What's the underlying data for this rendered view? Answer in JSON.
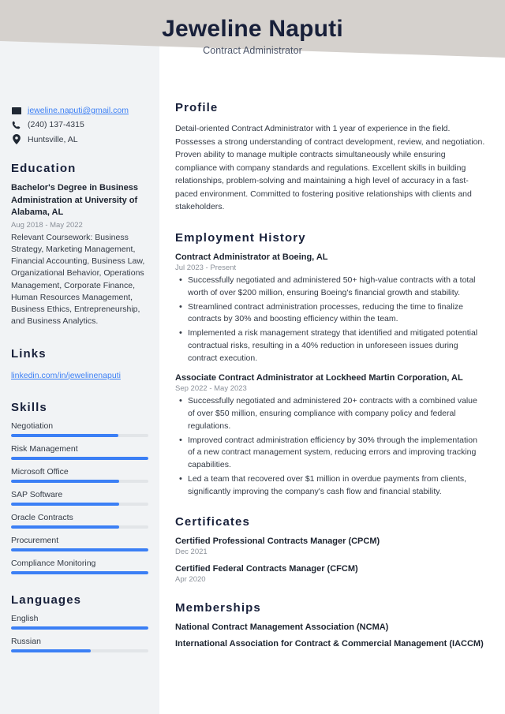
{
  "header": {
    "name": "Jeweline Naputi",
    "job_title": "Contract Administrator",
    "band_color": "#d5d1cd",
    "name_color": "#18203a"
  },
  "theme": {
    "accent": "#3b7ff5",
    "sidebar_bg": "#f1f3f5",
    "heading_color": "#18203a",
    "body_color": "#333a45",
    "muted_color": "#8a9099"
  },
  "sidebar": {
    "contact": [
      {
        "icon": "envelope-icon",
        "text": "jeweline.naputi@gmail.com",
        "is_link": true
      },
      {
        "icon": "phone-icon",
        "text": "(240) 137-4315",
        "is_link": false
      },
      {
        "icon": "location-pin-icon",
        "text": "Huntsville, AL",
        "is_link": false
      }
    ],
    "education": {
      "heading": "Education",
      "degree": "Bachelor's Degree in Business Administration at University of Alabama, AL",
      "date": "Aug 2018 - May 2022",
      "description": "Relevant Coursework: Business Strategy, Marketing Management, Financial Accounting, Business Law, Organizational Behavior, Operations Management, Corporate Finance, Human Resources Management, Business Ethics, Entrepreneurship, and Business Analytics."
    },
    "links": {
      "heading": "Links",
      "items": [
        {
          "label": "linkedin.com/in/jewelinenaputi"
        }
      ]
    },
    "skills": {
      "heading": "Skills",
      "items": [
        {
          "label": "Negotiation",
          "level": 78
        },
        {
          "label": "Risk Management",
          "level": 100
        },
        {
          "label": "Microsoft Office",
          "level": 79
        },
        {
          "label": "SAP Software",
          "level": 79
        },
        {
          "label": "Oracle Contracts",
          "level": 79
        },
        {
          "label": "Procurement",
          "level": 100
        },
        {
          "label": "Compliance Monitoring",
          "level": 100
        }
      ]
    },
    "languages": {
      "heading": "Languages",
      "items": [
        {
          "label": "English",
          "level": 100
        },
        {
          "label": "Russian",
          "level": 58
        }
      ]
    }
  },
  "main": {
    "profile": {
      "heading": "Profile",
      "text": "Detail-oriented Contract Administrator with 1 year of experience in the field. Possesses a strong understanding of contract development, review, and negotiation. Proven ability to manage multiple contracts simultaneously while ensuring compliance with company standards and regulations. Excellent skills in building relationships, problem-solving and maintaining a high level of accuracy in a fast-paced environment. Committed to fostering positive relationships with clients and stakeholders."
    },
    "employment": {
      "heading": "Employment History",
      "jobs": [
        {
          "title": "Contract Administrator at Boeing, AL",
          "date": "Jul 2023 - Present",
          "bullets": [
            "Successfully negotiated and administered 50+ high-value contracts with a total worth of over $200 million, ensuring Boeing's financial growth and stability.",
            "Streamlined contract administration processes, reducing the time to finalize contracts by 30% and boosting efficiency within the team.",
            "Implemented a risk management strategy that identified and mitigated potential contractual risks, resulting in a 40% reduction in unforeseen issues during contract execution."
          ]
        },
        {
          "title": "Associate Contract Administrator at Lockheed Martin Corporation, AL",
          "date": "Sep 2022 - May 2023",
          "bullets": [
            "Successfully negotiated and administered 20+ contracts with a combined value of over $50 million, ensuring compliance with company policy and federal regulations.",
            "Improved contract administration efficiency by 30% through the implementation of a new contract management system, reducing errors and improving tracking capabilities.",
            "Led a team that recovered over $1 million in overdue payments from clients, significantly improving the company's cash flow and financial stability."
          ]
        }
      ]
    },
    "certificates": {
      "heading": "Certificates",
      "items": [
        {
          "name": "Certified Professional Contracts Manager (CPCM)",
          "date": "Dec 2021"
        },
        {
          "name": "Certified Federal Contracts Manager (CFCM)",
          "date": "Apr 2020"
        }
      ]
    },
    "memberships": {
      "heading": "Memberships",
      "items": [
        {
          "name": "National Contract Management Association (NCMA)"
        },
        {
          "name": "International Association for Contract & Commercial Management (IACCM)"
        }
      ]
    }
  }
}
